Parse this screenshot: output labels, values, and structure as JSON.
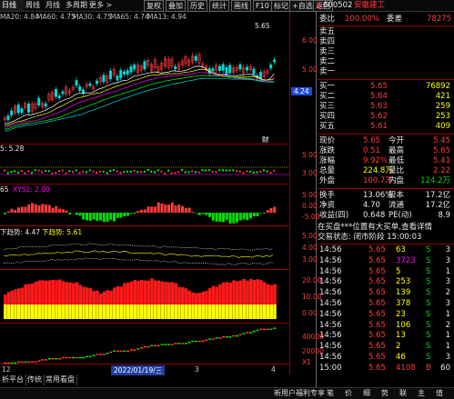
{
  "toolbar": {
    "tabs": [
      "日线",
      "周线",
      "月线",
      "多周期",
      "更多 >"
    ],
    "buttons": [
      "复权",
      "叠加",
      "历史",
      "统计",
      "画线",
      "F10",
      "标记",
      "+自选",
      "返回"
    ]
  },
  "main_chart": {
    "ma_legend": [
      {
        "label": "MA20: 4.84",
        "color": "#ffffff"
      },
      {
        "label": "MA60: 4.75",
        "color": "#ffff00"
      },
      {
        "label": "MA30: 4.75",
        "color": "#ff00ff"
      },
      {
        "label": "MA65: 4.74",
        "color": "#00ff00"
      },
      {
        "label": "MA13: 4.94",
        "color": "#00d8d8"
      }
    ],
    "high_marker": "5.65",
    "price_axis": [
      "6.00",
      "5.00",
      "4.24"
    ],
    "current_price_tag": "4.24",
    "cai_label": "财",
    "x_label": "3"
  },
  "indicators": {
    "ind1": {
      "label": "5: 5.28",
      "axis": [
        "5.00",
        "3.00"
      ]
    },
    "ind2": {
      "label": "65",
      "sub": "XYS2: 2.09",
      "axis": [
        "5.00",
        "0.00",
        "-5.00"
      ]
    },
    "ind3": {
      "label": "下趋势: 4.47",
      "sub": "下趋势: 5.61",
      "axis": [
        "5.00",
        "4.00",
        "3.00"
      ]
    },
    "ind4": {
      "axis": [
        "20.00",
        "10.00",
        "0.00"
      ]
    },
    "ind5": {
      "axis": [
        "40000",
        "20000",
        "X1"
      ]
    }
  },
  "bottom": {
    "date_label": "2022/01/19/三",
    "x_labels": [
      "12",
      "3",
      "4"
    ],
    "tabs": [
      "析平台",
      "传统",
      "常用看盘"
    ]
  },
  "quote": {
    "code": "600502",
    "name": "安徽建工",
    "weibi_label": "委比",
    "weibi_value": "100.00%",
    "weicha_label": "委差",
    "weicha_value": "78275",
    "sell": [
      {
        "label": "卖五",
        "price": "",
        "vol": ""
      },
      {
        "label": "卖四",
        "price": "",
        "vol": ""
      },
      {
        "label": "卖三",
        "price": "",
        "vol": ""
      },
      {
        "label": "卖二",
        "price": "",
        "vol": ""
      },
      {
        "label": "卖一",
        "price": "",
        "vol": ""
      }
    ],
    "buy": [
      {
        "label": "买一",
        "price": "5.65",
        "vol": "76892"
      },
      {
        "label": "买二",
        "price": "5.64",
        "vol": "421"
      },
      {
        "label": "买三",
        "price": "5.63",
        "vol": "259"
      },
      {
        "label": "买四",
        "price": "5.62",
        "vol": "253"
      },
      {
        "label": "买五",
        "price": "5.61",
        "vol": "409"
      }
    ],
    "stats": [
      {
        "l1": "现价",
        "v1": "5.65",
        "l2": "今开",
        "v2": "5.45"
      },
      {
        "l1": "涨跌",
        "v1": "0.51",
        "l2": "最高",
        "v2": "5.65"
      },
      {
        "l1": "涨幅",
        "v1": "9.92%",
        "l2": "最低",
        "v2": "5.41"
      },
      {
        "l1": "总量",
        "v1": "224.8万",
        "l2": "量比",
        "v2": "2.22"
      },
      {
        "l1": "外盘",
        "v1": "100.7万",
        "l2": "内盘",
        "v2": "124.2万"
      }
    ],
    "stats2": [
      {
        "l1": "换手",
        "v1": "13.06%",
        "l2": "股本",
        "v2": "17.2亿"
      },
      {
        "l1": "净资",
        "v1": "4.70",
        "l2": "流通",
        "v2": "17.2亿"
      },
      {
        "l1": "收益(四)",
        "v1": "0.648",
        "l2": "PE(动)",
        "v2": "8.9"
      }
    ],
    "notice": "在买盘***位置有大买单,查看详情",
    "trade_status": "交易状态: 闭市阶段 15:00:03"
  },
  "ticks": [
    {
      "time": "14:56",
      "price": "5.65",
      "vol": "63",
      "flag": "S",
      "n": "3"
    },
    {
      "time": "14:56",
      "price": "5.65",
      "vol": "3723",
      "flag": "S",
      "n": "3"
    },
    {
      "time": "14:56",
      "price": "5.65",
      "vol": "5",
      "flag": "S",
      "n": "1"
    },
    {
      "time": "14:56",
      "price": "5.65",
      "vol": "253",
      "flag": "S",
      "n": "3"
    },
    {
      "time": "14:56",
      "price": "5.65",
      "vol": "139",
      "flag": "S",
      "n": "2"
    },
    {
      "time": "14:56",
      "price": "5.65",
      "vol": "378",
      "flag": "S",
      "n": "3"
    },
    {
      "time": "14:56",
      "price": "5.65",
      "vol": "23",
      "flag": "S",
      "n": "1"
    },
    {
      "time": "14:56",
      "price": "5.65",
      "vol": "106",
      "flag": "S",
      "n": "2"
    },
    {
      "time": "14:56",
      "price": "5.65",
      "vol": "13",
      "flag": "S",
      "n": "1"
    },
    {
      "time": "14:56",
      "price": "5.65",
      "vol": "2",
      "flag": "S",
      "n": "1"
    },
    {
      "time": "14:56",
      "price": "5.65",
      "vol": "46",
      "flag": "S",
      "n": "3"
    },
    {
      "time": "15:00",
      "price": "5.65",
      "vol": "4108",
      "flag": "B",
      "n": "60"
    }
  ],
  "right_tabs": [
    "笔",
    "价",
    "细",
    "势",
    "联",
    "主",
    "值"
  ],
  "status_left": "新用户福利专享",
  "colors": {
    "up": "#ff3b3b",
    "down": "#00e000",
    "grid": "#8b0000",
    "yellow": "#ffff00"
  }
}
